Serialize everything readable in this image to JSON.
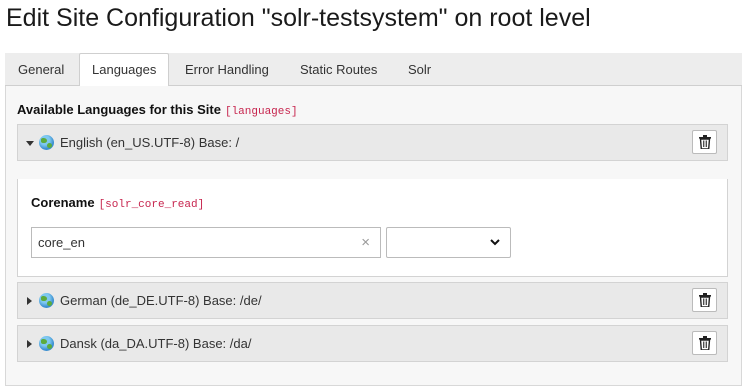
{
  "page": {
    "title": "Edit Site Configuration \"solr-testsystem\" on root level"
  },
  "tabs": [
    {
      "label": "General",
      "active": false
    },
    {
      "label": "Languages",
      "active": true
    },
    {
      "label": "Error Handling",
      "active": false
    },
    {
      "label": "Static Routes",
      "active": false
    },
    {
      "label": "Solr",
      "active": false
    }
  ],
  "languages_section": {
    "label": "Available Languages for this Site",
    "field_tag": "[languages]",
    "items": [
      {
        "title": "English (en_US.UTF-8) Base: /",
        "expanded": true,
        "icon": "globe-icon"
      },
      {
        "title": "German (de_DE.UTF-8) Base: /de/",
        "expanded": false,
        "icon": "globe-icon"
      },
      {
        "title": "Dansk (da_DA.UTF-8) Base: /da/",
        "expanded": false,
        "icon": "globe-icon"
      }
    ],
    "delete_icon": "trash-icon"
  },
  "corename": {
    "label": "Corename",
    "field_tag": "[solr_core_read]",
    "value": "core_en",
    "clear_symbol": "×",
    "select_value": ""
  },
  "colors": {
    "accent_code": "#c7254e",
    "header_bg": "#e9e9e9",
    "tabbar_bg": "#ededed"
  }
}
